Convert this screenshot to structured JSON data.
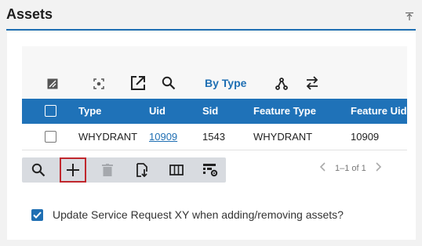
{
  "panel": {
    "title": "Assets"
  },
  "toolbar": {
    "by_type_label": "By Type",
    "icons": [
      "clear-selection-icon",
      "zoom-to-selection-icon",
      "open-external-icon",
      "search-icon",
      "branch-icon",
      "swap-icon"
    ]
  },
  "table": {
    "columns": [
      "Type",
      "Uid",
      "Sid",
      "Feature Type",
      "Feature Uid"
    ],
    "rows": [
      {
        "type": "WHYDRANT",
        "uid": "10909",
        "sid": "1543",
        "feature_type": "WHYDRANT",
        "feature_uid": "10909"
      }
    ]
  },
  "bottom_toolbar": {
    "icons": [
      "search-icon",
      "add-icon",
      "delete-icon",
      "import-icon",
      "columns-icon",
      "table-settings-icon"
    ],
    "selected": "add-icon"
  },
  "pager": {
    "range_text": "1–1 of 1"
  },
  "update_option": {
    "label": "Update Service Request XY when adding/removing assets?",
    "checked": true
  },
  "colors": {
    "accent": "#1f6fb3",
    "header_bg": "#1f72b8",
    "selected_outline": "#c0272d"
  }
}
